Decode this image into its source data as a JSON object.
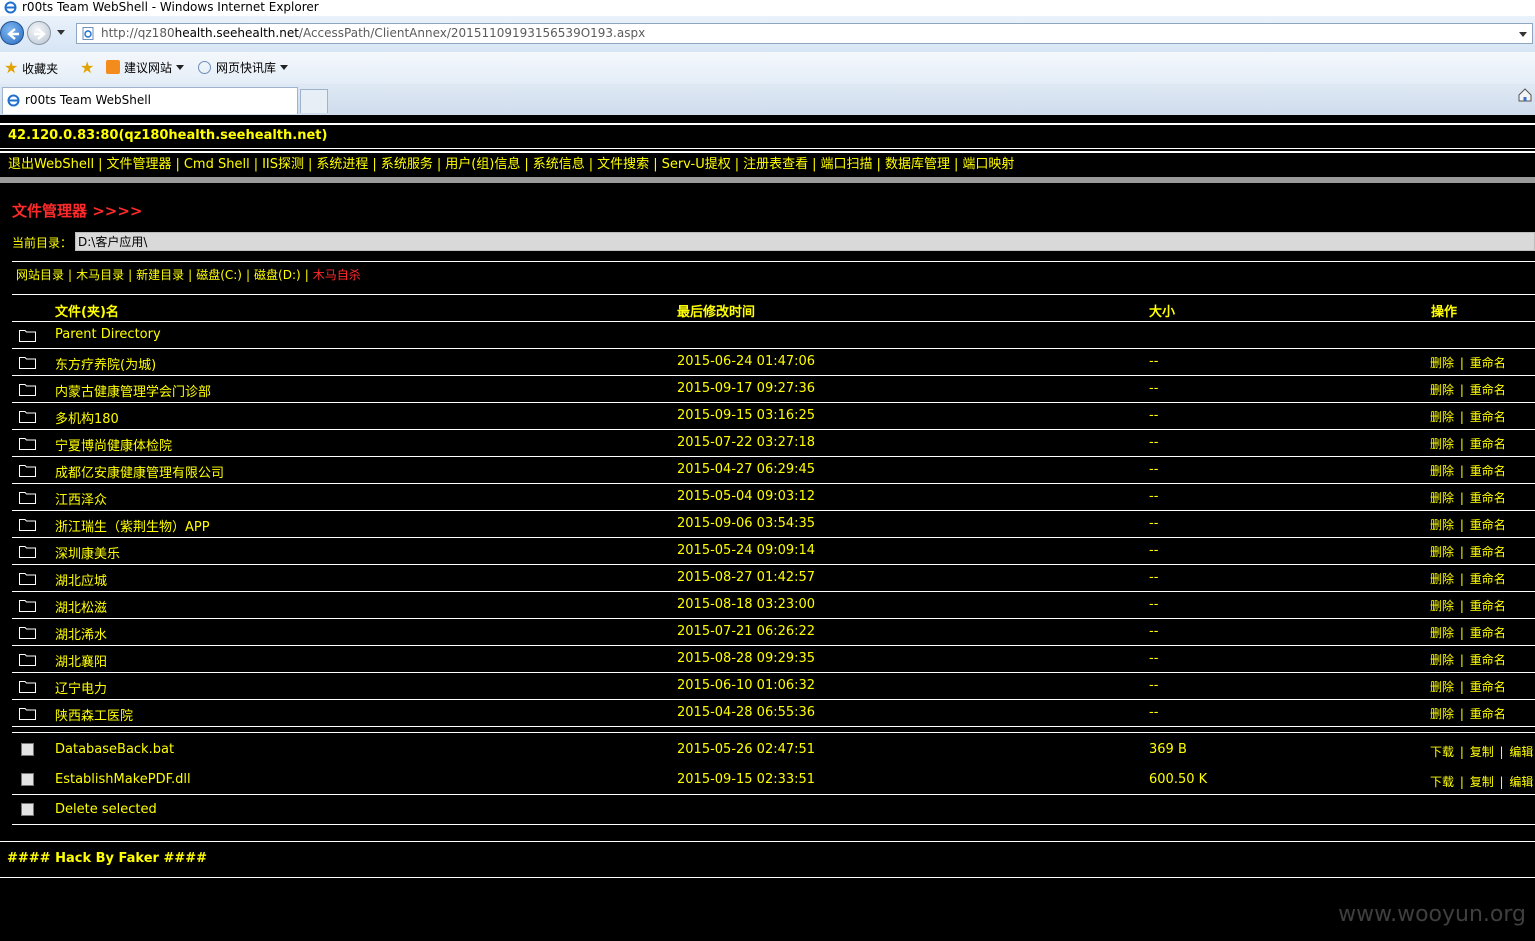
{
  "window": {
    "title": "r00ts Team WebShell - Windows Internet Explorer"
  },
  "address_bar": {
    "url_prefix": "http://qz180",
    "url_domain": "health.seehealth.net",
    "url_path": "/AccessPath/ClientAnnex/20151109193156539O193.aspx"
  },
  "favorites_bar": {
    "favorites_label": "收藏夹",
    "suggested_sites": "建议网站",
    "web_slice_gallery": "网页快讯库"
  },
  "tab": {
    "title": "r00ts Team WebShell"
  },
  "shell": {
    "host": "42.120.0.83:80(qz180health.seehealth.net)",
    "menu": [
      "退出WebShell",
      "文件管理器",
      "Cmd Shell",
      "IIS探测",
      "系统进程",
      "系统服务",
      "用户(组)信息",
      "系统信息",
      "文件搜索",
      "Serv-U提权",
      "注册表查看",
      "端口扫描",
      "数据库管理",
      "端口映射"
    ]
  },
  "file_manager": {
    "title": "文件管理器 >>>>",
    "current_dir_label": "当前目录：",
    "current_dir": "D:\\客户应用\\",
    "quick_links": [
      "网站目录",
      "木马目录",
      "新建目录",
      "磁盘(C:)",
      "磁盘(D:)"
    ],
    "kill_self": "木马自杀",
    "columns": {
      "name": "文件(夹)名",
      "modified": "最后修改时间",
      "size": "大小",
      "actions": "操作"
    },
    "parent_directory": "Parent Directory",
    "folders": [
      {
        "name": "东方疗养院(为城)",
        "modified": "2015-06-24 01:47:06",
        "size": "--"
      },
      {
        "name": "内蒙古健康管理学会门诊部",
        "modified": "2015-09-17 09:27:36",
        "size": "--"
      },
      {
        "name": "多机构180",
        "modified": "2015-09-15 03:16:25",
        "size": "--"
      },
      {
        "name": "宁夏博尚健康体检院",
        "modified": "2015-07-22 03:27:18",
        "size": "--"
      },
      {
        "name": "成都亿安康健康管理有限公司",
        "modified": "2015-04-27 06:29:45",
        "size": "--"
      },
      {
        "name": "江西泽众",
        "modified": "2015-05-04 09:03:12",
        "size": "--"
      },
      {
        "name": "浙江瑞生（紫荆生物）APP",
        "modified": "2015-09-06 03:54:35",
        "size": "--"
      },
      {
        "name": "深圳康美乐",
        "modified": "2015-05-24 09:09:14",
        "size": "--"
      },
      {
        "name": "湖北应城",
        "modified": "2015-08-27 01:42:57",
        "size": "--"
      },
      {
        "name": "湖北松滋",
        "modified": "2015-08-18 03:23:00",
        "size": "--"
      },
      {
        "name": "湖北浠水",
        "modified": "2015-07-21 06:26:22",
        "size": "--"
      },
      {
        "name": "湖北襄阳",
        "modified": "2015-08-28 09:29:35",
        "size": "--"
      },
      {
        "name": "辽宁电力",
        "modified": "2015-06-10 01:06:32",
        "size": "--"
      },
      {
        "name": "陕西森工医院",
        "modified": "2015-04-28 06:55:36",
        "size": "--"
      }
    ],
    "folder_actions": {
      "delete": "删除",
      "rename": "重命名"
    },
    "files": [
      {
        "name": "DatabaseBack.bat",
        "modified": "2015-05-26 02:47:51",
        "size": "369 B"
      },
      {
        "name": "EstablishMakePDF.dll",
        "modified": "2015-09-15 02:33:51",
        "size": "600.50 K"
      }
    ],
    "file_actions": {
      "download": "下载",
      "copy": "复制",
      "edit": "编辑"
    },
    "delete_selected": "Delete selected"
  },
  "footer": "#### Hack By Faker ####",
  "watermark": "www.wooyun.org",
  "colors": {
    "accent_text": "#ffff00",
    "warning_text": "#ff2a2a",
    "background": "#000000"
  }
}
